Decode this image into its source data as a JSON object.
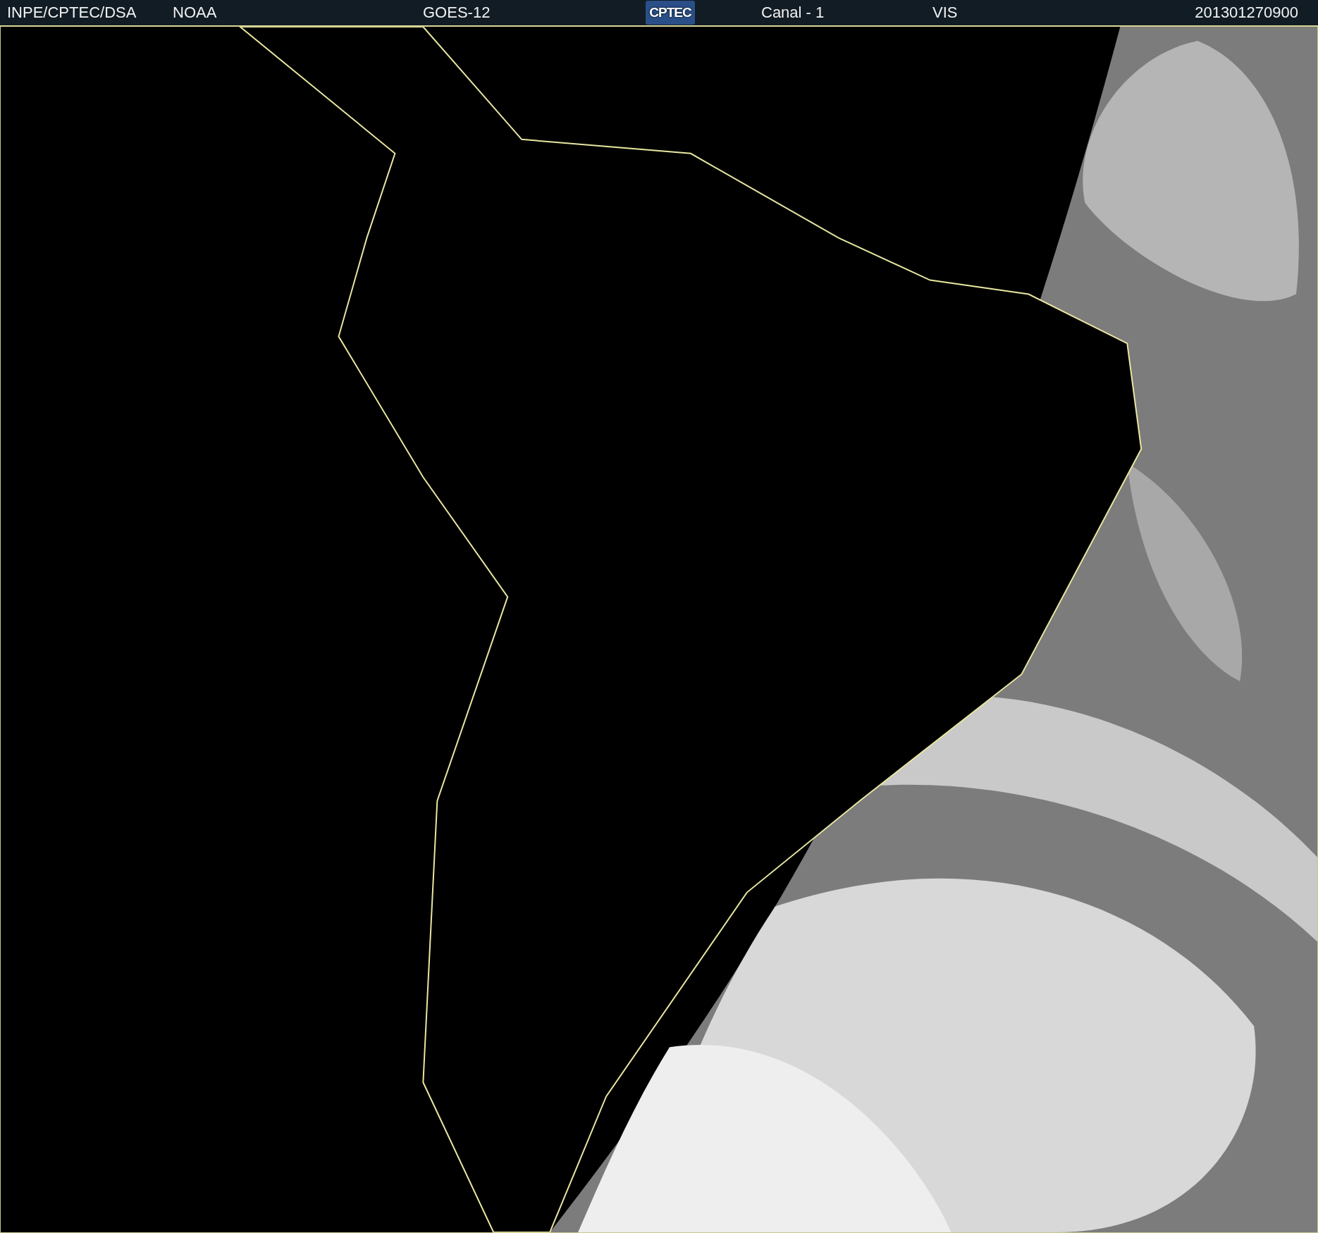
{
  "header": {
    "items": [
      {
        "kind": "text",
        "text": "INPE/CPTEC/DSA"
      },
      {
        "kind": "text",
        "text": "NOAA"
      },
      {
        "kind": "text",
        "text": "GOES-12"
      },
      {
        "kind": "logo",
        "text": "CPTEC"
      },
      {
        "kind": "text",
        "text": "Canal - 1"
      },
      {
        "kind": "text",
        "text": "VIS"
      },
      {
        "kind": "text",
        "text": "201301270900"
      }
    ]
  }
}
